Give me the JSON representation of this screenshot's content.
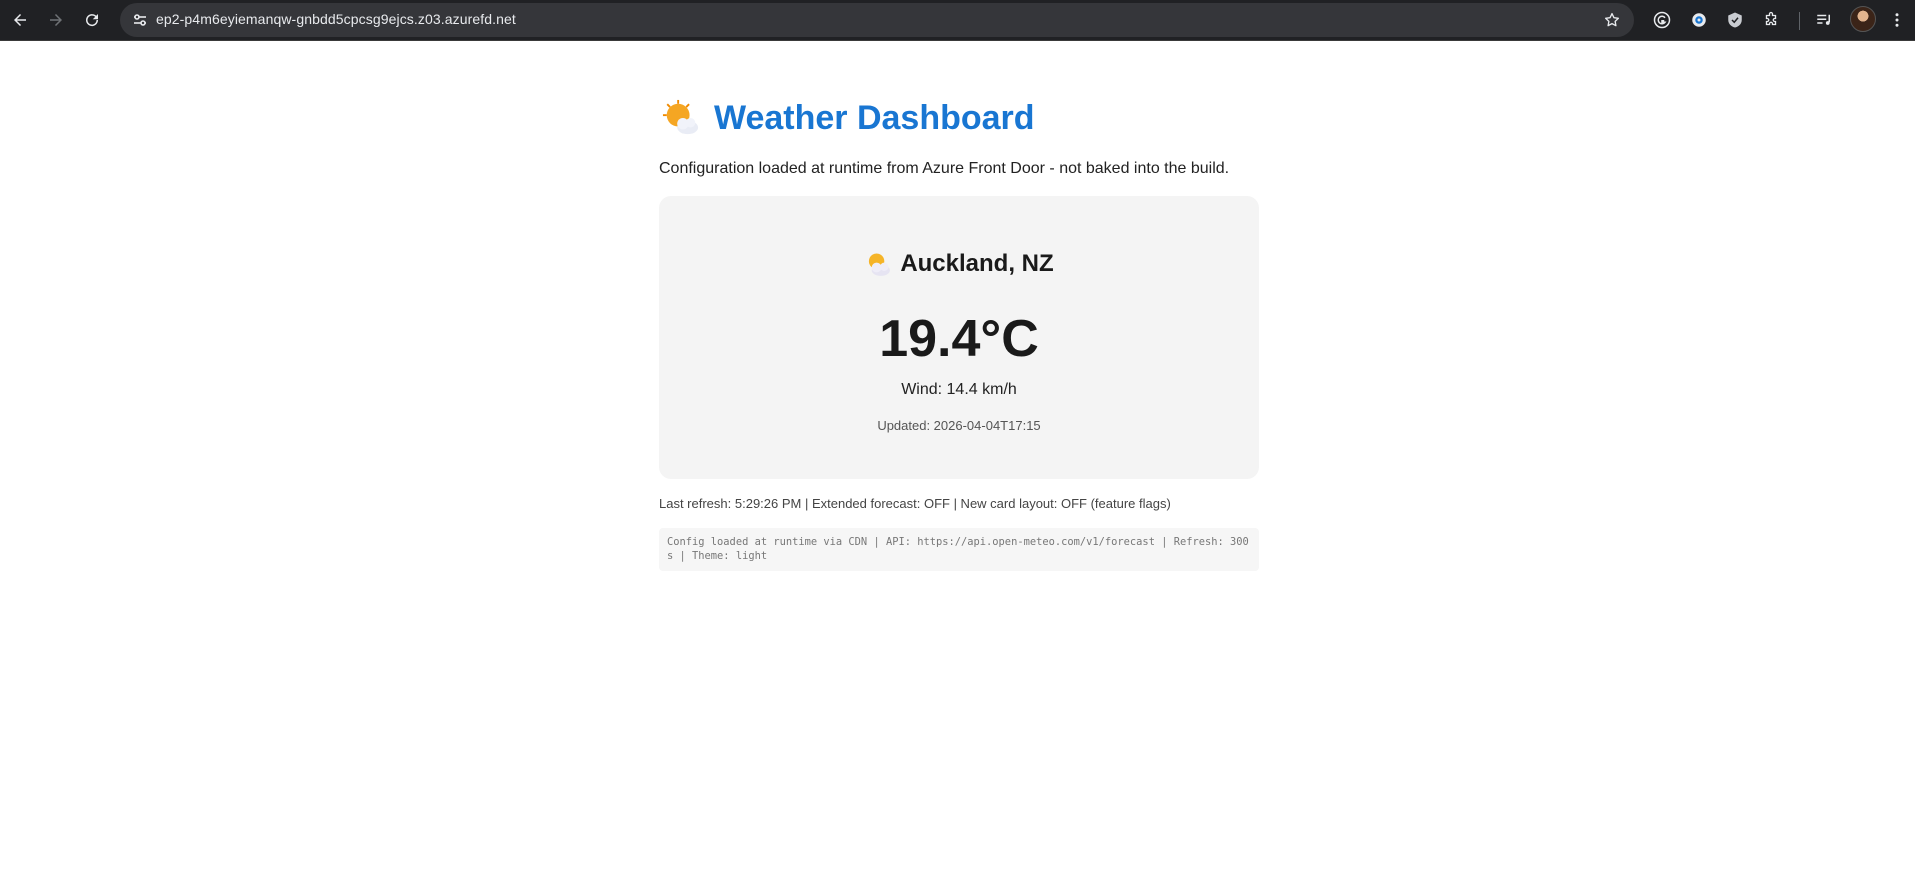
{
  "browser": {
    "url": "ep2-p4m6eyiemanqw-gnbdd5cpcsg9ejcs.z03.azurefd.net",
    "toolbar_icons": [
      "grammarly-icon",
      "password-manager-icon",
      "extension-shield-icon",
      "extensions-puzzle-icon",
      "media-controls-icon"
    ]
  },
  "page": {
    "title": "Weather Dashboard",
    "title_icon": "sun-behind-cloud-icon",
    "subtitle": "Configuration loaded at runtime from Azure Front Door - not baked into the build.",
    "accent_color": "#1976d2"
  },
  "weather": {
    "icon": "sun-behind-cloud-icon",
    "city": "Auckland, NZ",
    "temperature": "19.4°C",
    "wind": "Wind: 14.4 km/h",
    "updated": "Updated: 2026-04-04T17:15"
  },
  "status": {
    "refresh_line": "Last refresh: 5:29:26 PM | Extended forecast: OFF | New card layout: OFF (feature flags)"
  },
  "config": {
    "line": "Config loaded at runtime via CDN | API: https://api.open-meteo.com/v1/forecast | Refresh: 300s | Theme: light"
  }
}
